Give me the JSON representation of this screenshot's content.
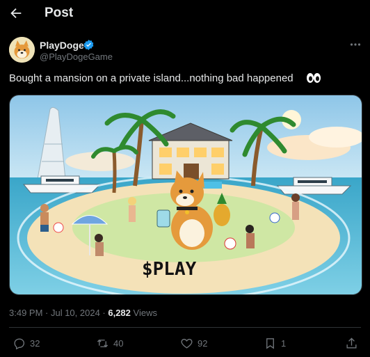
{
  "header": {
    "title": "Post"
  },
  "author": {
    "name": "PlayDoge",
    "handle": "@PlayDogeGame"
  },
  "tweet": {
    "text": "Bought a mansion on a private island...nothing bad happened"
  },
  "media": {
    "caption": "$PLAY"
  },
  "meta": {
    "time": "3:49 PM · Jul 10, 2024 · ",
    "views_count": "6,282",
    "views_label": " Views"
  },
  "actions": {
    "replies": "32",
    "reposts": "40",
    "likes": "92",
    "bookmarks": "1"
  },
  "colors": {
    "background": "#000000",
    "text": "#e7e9ea",
    "muted": "#71767b",
    "verified": "#1d9bf0",
    "divider": "#2f3336"
  },
  "icons": [
    "back-arrow-icon",
    "verified-badge-icon",
    "more-icon",
    "eyes-emoji-icon",
    "reply-icon",
    "repost-icon",
    "like-icon",
    "bookmark-icon",
    "share-icon"
  ]
}
